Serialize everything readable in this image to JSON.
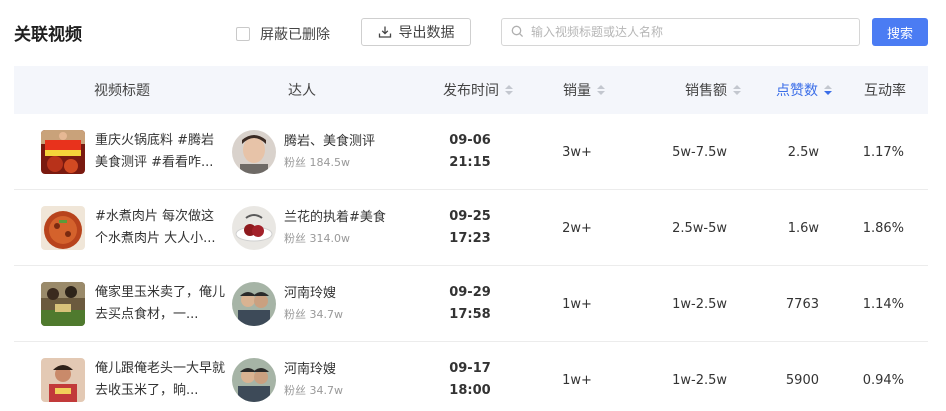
{
  "header": {
    "title": "关联视频",
    "hide_deleted_label": "屏蔽已删除",
    "export_label": "导出数据",
    "search_placeholder": "输入视频标题或达人名称",
    "search_button": "搜索"
  },
  "columns": {
    "title": "视频标题",
    "creator": "达人",
    "publish_time": "发布时间",
    "sales": "销量",
    "amount": "销售额",
    "likes": "点赞数",
    "engagement": "互动率"
  },
  "fans_prefix": "粉丝",
  "rows": [
    {
      "title": "重庆火锅底料 #腾岩美食测评 #看看咋...",
      "creator": "腾岩、美食测评",
      "fans": "184.5w",
      "date": "09-06",
      "time": "21:15",
      "sales": "3w+",
      "amount": "5w-7.5w",
      "likes": "2.5w",
      "rate": "1.17%"
    },
    {
      "title": "#水煮肉片 每次做这个水煮肉片 大人小...",
      "creator": "兰花的执着#美食",
      "fans": "314.0w",
      "date": "09-25",
      "time": "17:23",
      "sales": "2w+",
      "amount": "2.5w-5w",
      "likes": "1.6w",
      "rate": "1.86%"
    },
    {
      "title": "俺家里玉米卖了，俺儿去买点食材，一...",
      "creator": "河南玲嫂",
      "fans": "34.7w",
      "date": "09-29",
      "time": "17:58",
      "sales": "1w+",
      "amount": "1w-2.5w",
      "likes": "7763",
      "rate": "1.14%"
    },
    {
      "title": "俺儿跟俺老头一大早就去收玉米了，晌...",
      "creator": "河南玲嫂",
      "fans": "34.7w",
      "date": "09-17",
      "time": "18:00",
      "sales": "1w+",
      "amount": "1w-2.5w",
      "likes": "5900",
      "rate": "0.94%"
    }
  ],
  "colors": {
    "accent": "#4b7cf3",
    "sort_active": "#3b6ee8",
    "header_bg": "#f4f6fb"
  }
}
